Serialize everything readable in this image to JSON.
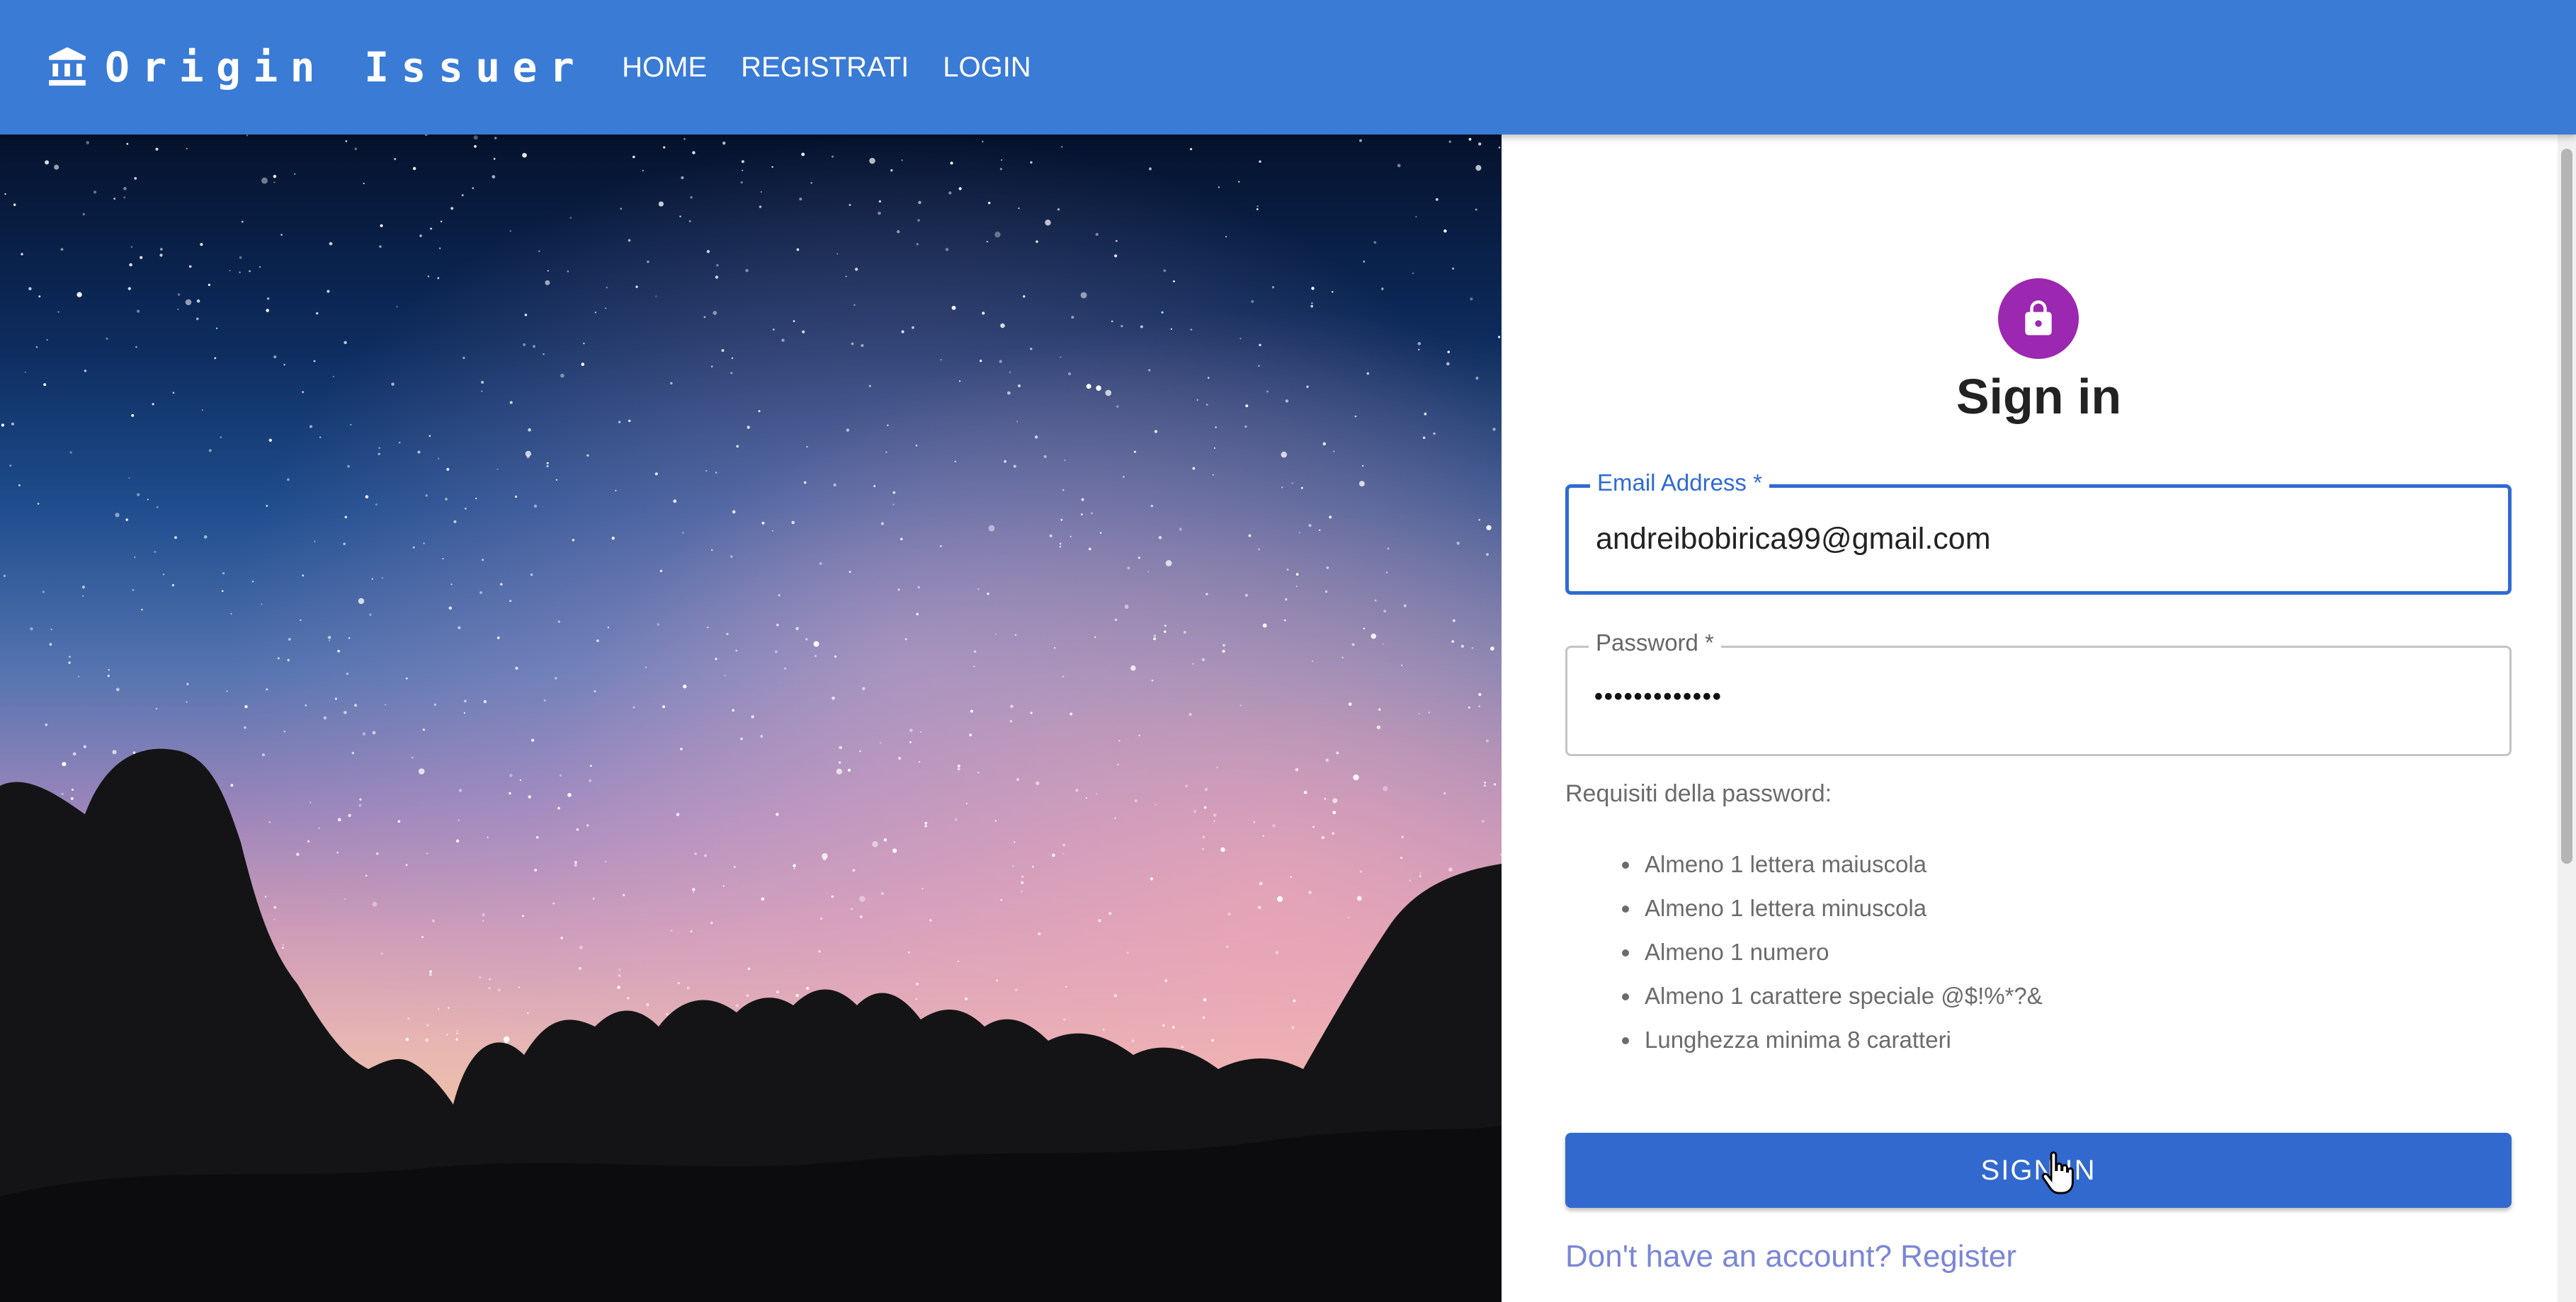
{
  "appbar": {
    "title": "Origin Issuer",
    "brand_icon": "bank-icon",
    "nav": [
      {
        "label": "HOME"
      },
      {
        "label": "REGISTRATI"
      },
      {
        "label": "LOGIN"
      }
    ],
    "color": "#3a7bd5"
  },
  "hero": {
    "image": "starry-sky-over-rocks"
  },
  "form": {
    "icon": "lock-icon",
    "icon_color": "#9c27b0",
    "heading": "Sign in",
    "email": {
      "label": "Email Address *",
      "value": "andreibobirica99@gmail.com"
    },
    "password": {
      "label": "Password *",
      "value": "•••••••••••••"
    },
    "requirements": {
      "title": "Requisiti della password:",
      "items": [
        "Almeno 1 lettera maiuscola",
        "Almeno 1 lettera minuscola",
        "Almeno 1 numero",
        "Almeno 1 carattere speciale @$!%*?&",
        "Lunghezza minima 8 caratteri"
      ]
    },
    "submit_label": "SIGN IN",
    "register_link": "Don't have an account? Register"
  }
}
